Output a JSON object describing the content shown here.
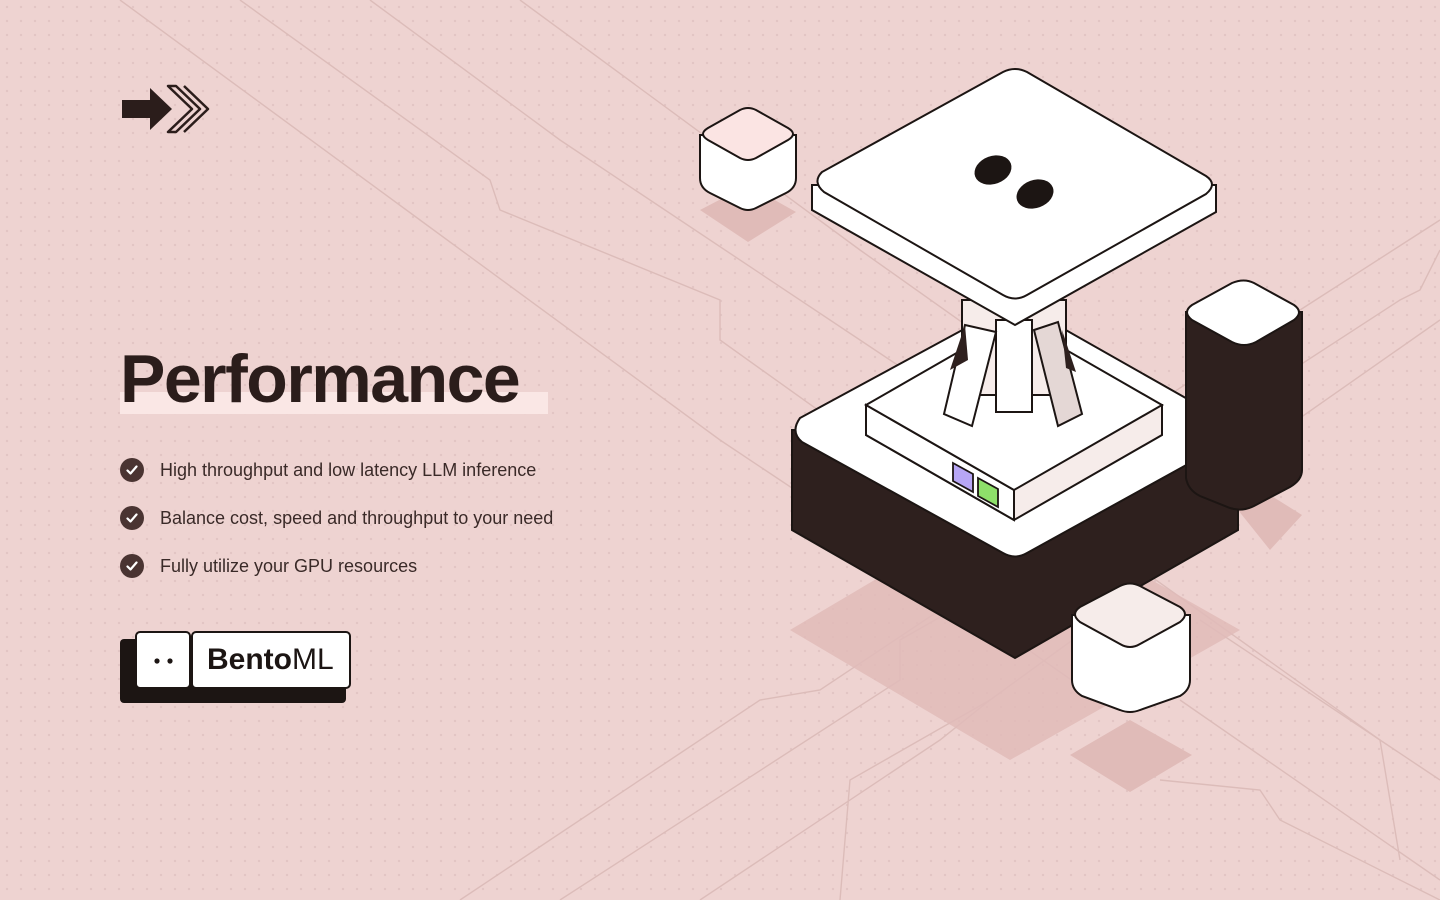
{
  "title": "Performance",
  "features": [
    {
      "icon": "check-icon",
      "text": "High throughput and low latency LLM inference"
    },
    {
      "icon": "check-icon",
      "text": "Balance cost, speed and throughput to your need"
    },
    {
      "icon": "check-icon",
      "text": "Fully utilize your GPU resources"
    }
  ],
  "brand": {
    "name_bold": "Bento",
    "name_regular": "ML"
  },
  "colors": {
    "background": "#eed3d1",
    "dark": "#2b1d1b",
    "highlight": "#fae7e5",
    "gpu_purple": "#b7a6f5",
    "gpu_green": "#8ee06a"
  },
  "icons": {
    "logo": "double-arrow-logo-icon",
    "illustration": "isometric-server-illustration"
  }
}
